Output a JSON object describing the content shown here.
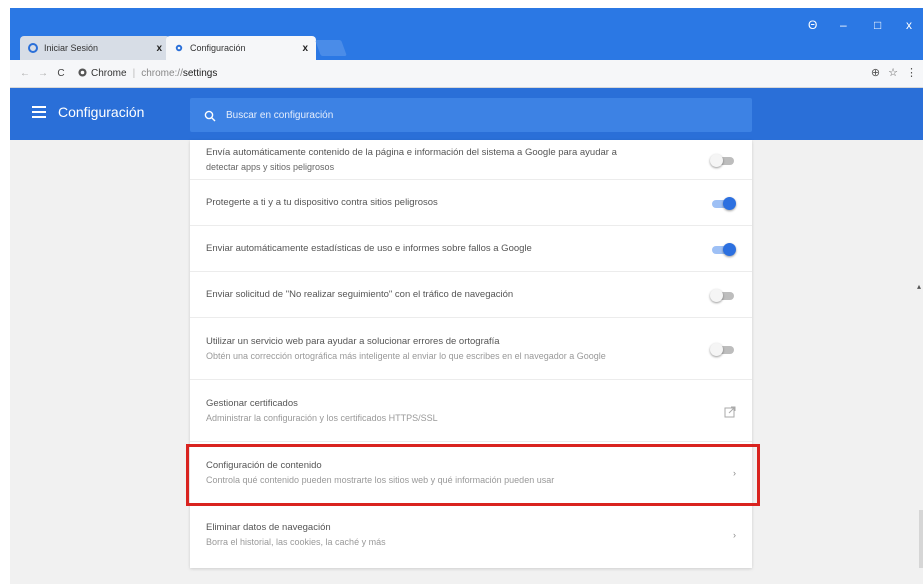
{
  "tabs": [
    {
      "label": "Iniciar Sesión",
      "close": "x"
    },
    {
      "label": "Configuración",
      "close": "x"
    }
  ],
  "window_controls": {
    "profile": "Θ",
    "minimize": "–",
    "maximize": "□",
    "close": "x"
  },
  "address_bar": {
    "chip": "Chrome",
    "separator": "|",
    "url_host": "chrome://",
    "url_path": "settings"
  },
  "header": {
    "title": "Configuración",
    "search_placeholder": "Buscar en configuración"
  },
  "settings_rows": [
    {
      "primary": "Envía automáticamente contenido de la página e información del sistema a Google para ayudar a",
      "secondary": "detectar apps y sitios peligrosos",
      "control": "toggle",
      "state": "off"
    },
    {
      "primary": "Protegerte a ti y a tu dispositivo contra sitios peligrosos",
      "control": "toggle",
      "state": "on"
    },
    {
      "primary": "Enviar automáticamente estadísticas de uso e informes sobre fallos a Google",
      "control": "toggle",
      "state": "on"
    },
    {
      "primary": "Enviar solicitud de \"No realizar seguimiento\" con el tráfico de navegación",
      "control": "toggle",
      "state": "off"
    },
    {
      "primary": "Utilizar un servicio web para ayudar a solucionar errores de ortografía",
      "secondary": "Obtén una corrección ortográfica más inteligente al enviar lo que escribes en el navegador a Google",
      "control": "toggle",
      "state": "off"
    },
    {
      "primary": "Gestionar certificados",
      "secondary": "Administrar la configuración y los certificados HTTPS/SSL",
      "control": "external"
    },
    {
      "primary": "Configuración de contenido",
      "secondary": "Controla qué contenido pueden mostrarte los sitios web y qué información pueden usar",
      "control": "chevron"
    },
    {
      "primary": "Eliminar datos de navegación",
      "secondary": "Borra el historial, las cookies, la caché y más",
      "control": "chevron"
    }
  ],
  "chevron": "›",
  "colors": {
    "tabstrip": "#2b78e4",
    "header": "#2a6fd8",
    "toggle_on": "#2c70e0",
    "highlight": "#d9231f"
  }
}
